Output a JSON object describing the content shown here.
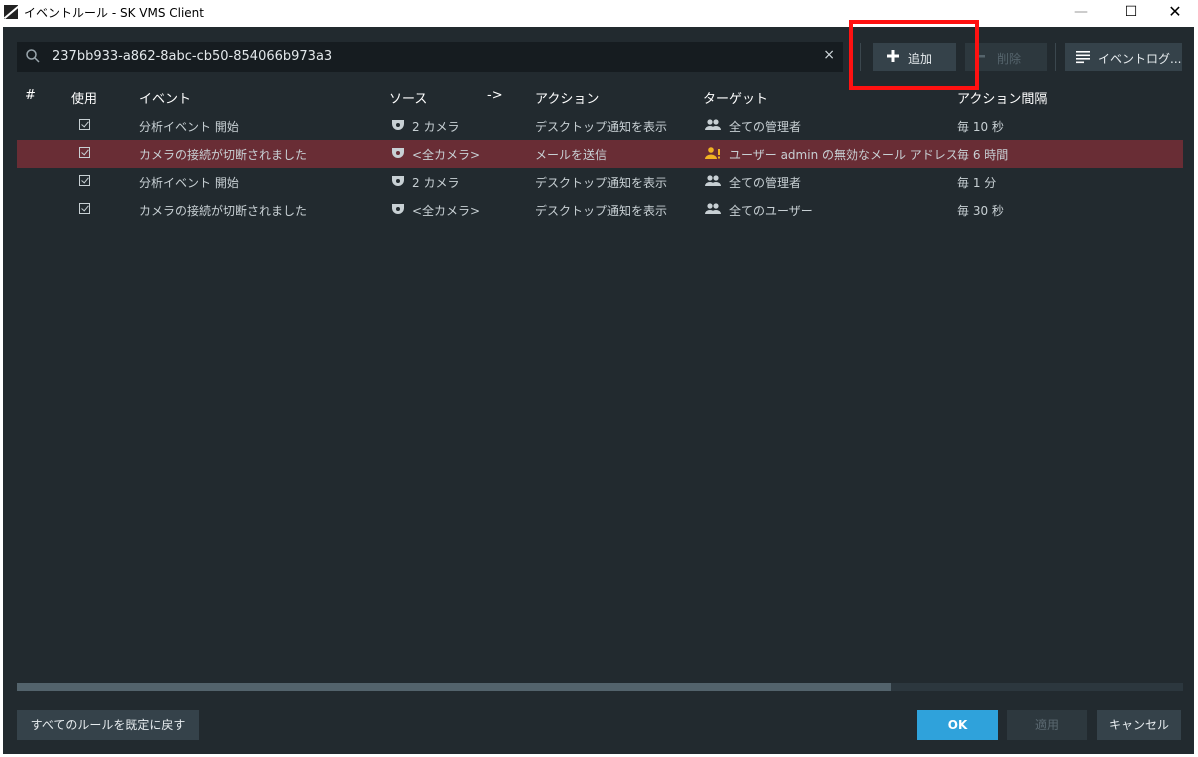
{
  "window": {
    "title": "イベントルール - SK VMS Client",
    "minimize": "—",
    "maximize": "☐",
    "close": "✕"
  },
  "search": {
    "value": "237bb933-a862-8abc-cb50-854066b973a3",
    "clear": "×"
  },
  "toolbar": {
    "add_label": "追加",
    "delete_label": "削除",
    "log_label": "イベントログ..."
  },
  "columns": {
    "num": "#",
    "enabled": "使用",
    "event": "イベント",
    "source": "ソース",
    "arrow": "->",
    "action": "アクション",
    "target": "ターゲット",
    "interval": "アクション間隔"
  },
  "rows": [
    {
      "event": "分析イベント 開始",
      "source": "2 カメラ",
      "action": "デスクトップ通知を表示",
      "target": "全ての管理者",
      "interval": "毎 10 秒",
      "selected": false,
      "warning": false
    },
    {
      "event": "カメラの接続が切断されました",
      "source": "<全カメラ>",
      "action": "メールを送信",
      "target": "ユーザー admin の無効なメール アドレス",
      "interval": "毎 6 時間",
      "selected": true,
      "warning": true
    },
    {
      "event": "分析イベント 開始",
      "source": "2 カメラ",
      "action": "デスクトップ通知を表示",
      "target": "全ての管理者",
      "interval": "毎 1 分",
      "selected": false,
      "warning": false
    },
    {
      "event": "カメラの接続が切断されました",
      "source": "<全カメラ>",
      "action": "デスクトップ通知を表示",
      "target": "全てのユーザー",
      "interval": "毎 30 秒",
      "selected": false,
      "warning": false
    }
  ],
  "footer": {
    "reset_label": "すべてのルールを既定に戻す",
    "ok_label": "OK",
    "apply_label": "適用",
    "cancel_label": "キャンセル"
  },
  "colors": {
    "dialog_bg": "#222a2f",
    "selected_row": "#692d35",
    "ok_button": "#2fa2db",
    "highlight_box": "#ff1111",
    "warning_icon": "#f0b323"
  },
  "icons": {
    "search": "search-icon",
    "add": "plus-icon",
    "delete": "minus-icon",
    "log": "list-icon",
    "camera": "camera-icon",
    "users": "users-icon",
    "user_warning": "user-warning-icon",
    "checkbox": "checkbox-checked-icon"
  }
}
